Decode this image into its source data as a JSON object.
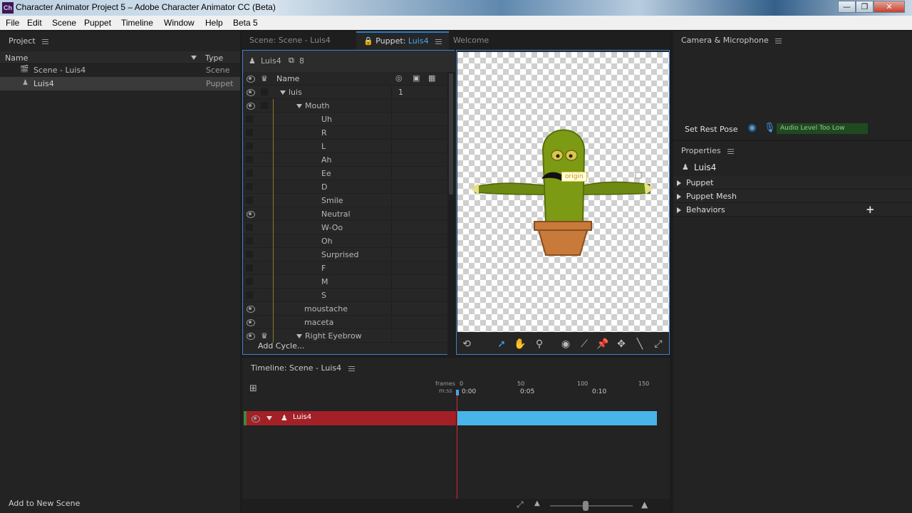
{
  "window": {
    "title": "Character Animator Project 5 – Adobe Character Animator CC (Beta)",
    "logo": "Ch",
    "min": "—",
    "max": "❐",
    "close": "✕"
  },
  "menu": [
    "File",
    "Edit",
    "Scene",
    "Puppet",
    "Timeline",
    "Window",
    "Help",
    "Beta 5"
  ],
  "project": {
    "title": "Project",
    "col_name": "Name",
    "col_type": "Type",
    "items": [
      {
        "name": "Scene - Luis4",
        "type": "Scene",
        "icon": "clapperboard-icon"
      },
      {
        "name": "Luis4",
        "type": "Puppet",
        "icon": "puppet-icon"
      }
    ],
    "add_to_new_scene": "Add to New Scene"
  },
  "tabs": {
    "scene": "Scene: Scene - Luis4",
    "puppet_prefix": "Puppet: ",
    "puppet_name": "Luis4",
    "welcome": "Welcome"
  },
  "puppet": {
    "name": "Luis4",
    "layer_count": "8",
    "col_name": "Name",
    "luis_value": "1",
    "layers": [
      {
        "name": "luis",
        "indent": 0,
        "expanded": true,
        "eye": true,
        "value": "1"
      },
      {
        "name": "Mouth",
        "indent": 1,
        "expanded": true,
        "eye": true
      },
      {
        "name": "Uh",
        "indent": 2,
        "eye": false
      },
      {
        "name": "R",
        "indent": 2,
        "eye": false
      },
      {
        "name": "L",
        "indent": 2,
        "eye": false
      },
      {
        "name": "Ah",
        "indent": 2,
        "eye": false
      },
      {
        "name": "Ee",
        "indent": 2,
        "eye": false
      },
      {
        "name": "D",
        "indent": 2,
        "eye": false
      },
      {
        "name": "Smile",
        "indent": 2,
        "eye": false
      },
      {
        "name": "Neutral",
        "indent": 2,
        "eye": true
      },
      {
        "name": "W-Oo",
        "indent": 2,
        "eye": false
      },
      {
        "name": "Oh",
        "indent": 2,
        "eye": false
      },
      {
        "name": "Surprised",
        "indent": 2,
        "eye": false
      },
      {
        "name": "F",
        "indent": 2,
        "eye": false
      },
      {
        "name": "M",
        "indent": 2,
        "eye": false
      },
      {
        "name": "S",
        "indent": 2,
        "eye": false
      },
      {
        "name": "moustache",
        "indent": 1,
        "eye": true
      },
      {
        "name": "maceta",
        "indent": 1,
        "eye": true
      },
      {
        "name": "Right Eyebrow",
        "indent": 1,
        "expanded": true,
        "eye": true,
        "crown": true
      }
    ],
    "add_cycle": "Add Cycle..."
  },
  "canvas": {
    "origin_label": "origin"
  },
  "camera": {
    "title": "Camera & Microphone",
    "set_rest_pose": "Set Rest Pose",
    "audio_level": "Audio Level Too Low"
  },
  "properties": {
    "title": "Properties",
    "puppet_name": "Luis4",
    "sections": [
      "Puppet",
      "Puppet Mesh",
      "Behaviors"
    ]
  },
  "timeline": {
    "title": "Timeline: Scene - Luis4",
    "frames_label": "frames",
    "mss_label": "m:ss",
    "frame_ticks": [
      "0",
      "50",
      "100",
      "150"
    ],
    "time_ticks": [
      "0:00",
      "0:05",
      "0:10"
    ],
    "track_name": "Luis4"
  },
  "colors": {
    "accent": "#3b84cf",
    "track_red": "#a32027",
    "clip_blue": "#48b4ea",
    "audio_green": "#1f4a1f"
  }
}
